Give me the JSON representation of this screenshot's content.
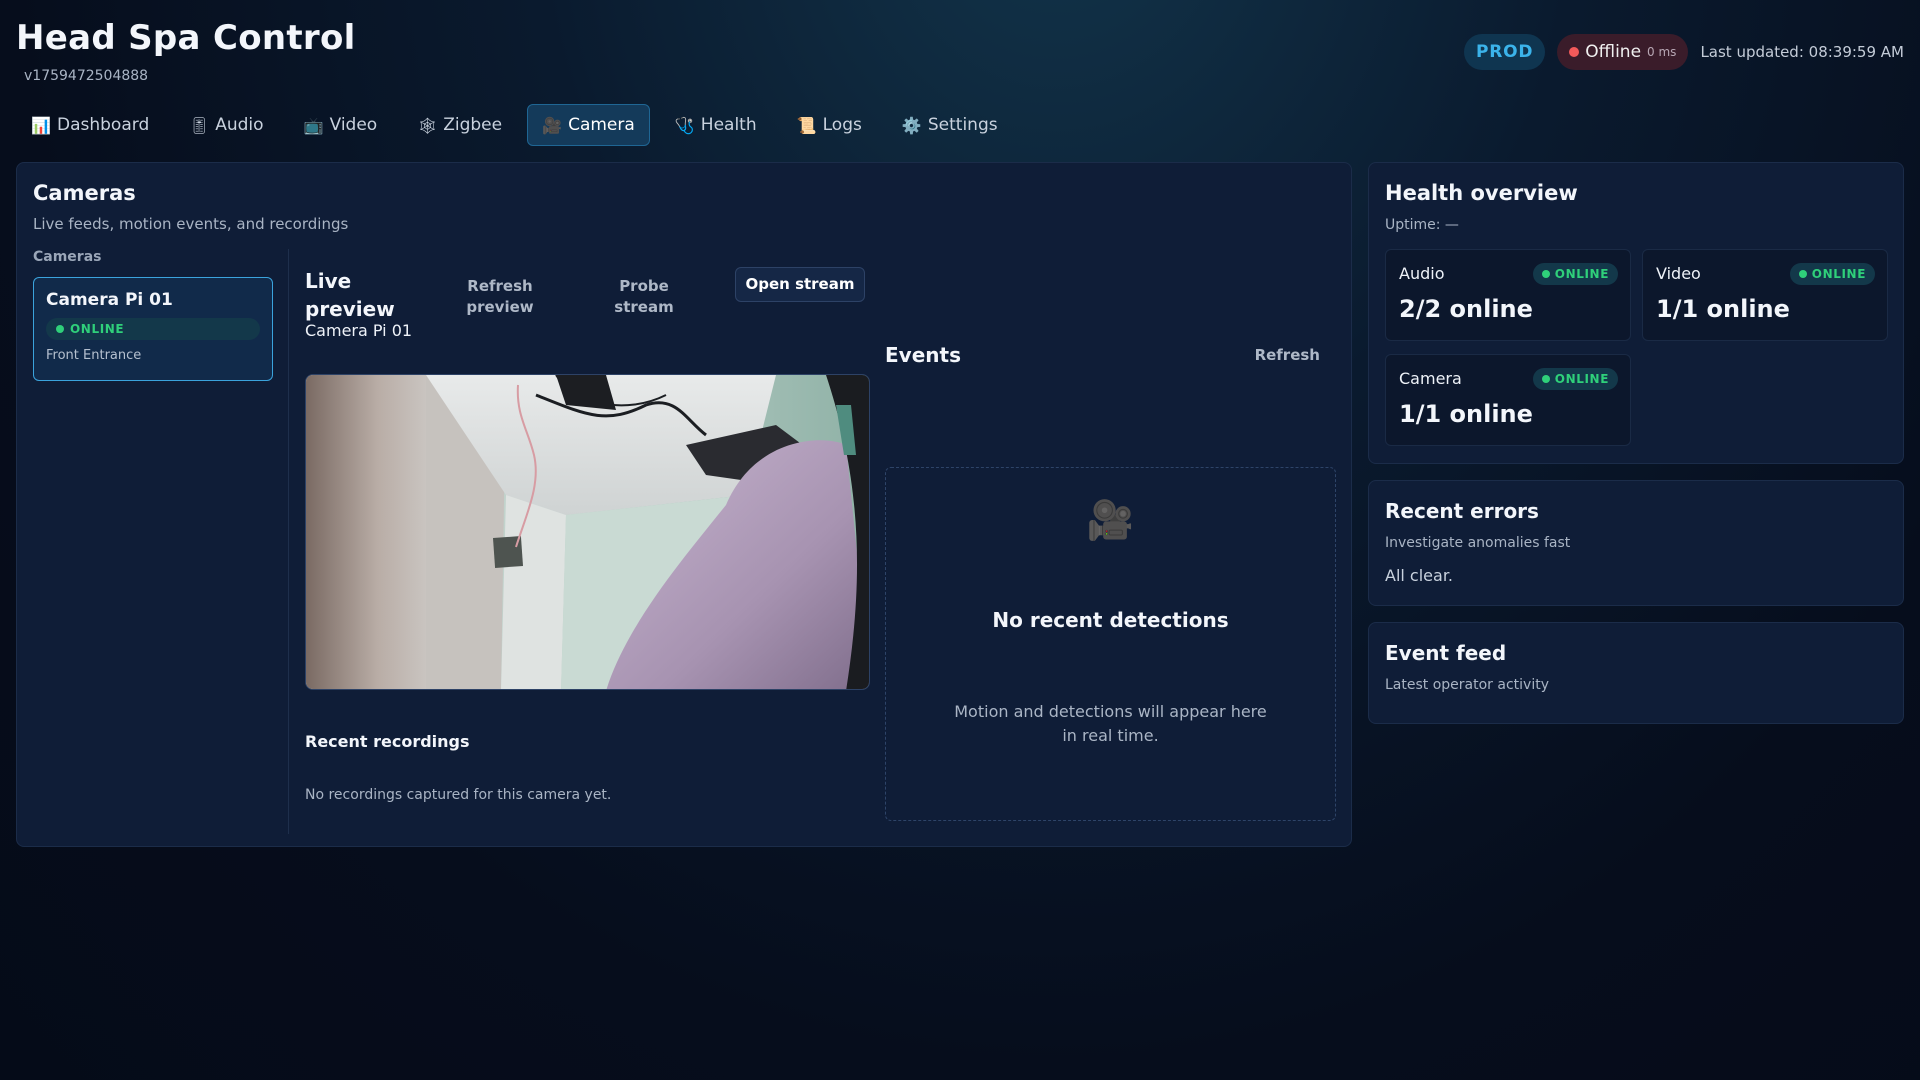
{
  "app": {
    "title": "Head Spa Control",
    "version": "v1759472504888"
  },
  "status": {
    "environment": "PROD",
    "connection": "Offline",
    "latency": "0 ms",
    "last_updated": "Last updated: 08:39:59 AM"
  },
  "nav": {
    "tabs": [
      {
        "label": "Dashboard",
        "icon": "bar-chart-icon",
        "glyph": "📊",
        "active": false
      },
      {
        "label": "Audio",
        "icon": "speaker-icon",
        "glyph": "🎚",
        "active": false
      },
      {
        "label": "Video",
        "icon": "tv-icon",
        "glyph": "📺",
        "active": false
      },
      {
        "label": "Zigbee",
        "icon": "network-icon",
        "glyph": "🕸",
        "active": false
      },
      {
        "label": "Camera",
        "icon": "video-camera-icon",
        "glyph": "🎥",
        "active": true
      },
      {
        "label": "Health",
        "icon": "stethoscope-icon",
        "glyph": "🩺",
        "active": false
      },
      {
        "label": "Logs",
        "icon": "scroll-icon",
        "glyph": "📜",
        "active": false
      },
      {
        "label": "Settings",
        "icon": "gear-icon",
        "glyph": "⚙️",
        "active": false
      }
    ]
  },
  "cameras_panel": {
    "title": "Cameras",
    "subtitle": "Live feeds, motion events, and recordings",
    "list_label": "Cameras",
    "cameras": [
      {
        "name": "Camera Pi 01",
        "status": "ONLINE",
        "location": "Front Entrance"
      }
    ]
  },
  "preview": {
    "title": "Live preview",
    "refresh_label": "Refresh preview",
    "probe_label": "Probe stream",
    "open_label": "Open stream",
    "camera_name": "Camera Pi 01",
    "recordings_title": "Recent recordings",
    "recordings_empty": "No recordings captured for this camera yet."
  },
  "events": {
    "title": "Events",
    "refresh_label": "Refresh",
    "empty_icon": "video-camera-icon",
    "empty_glyph": "🎥",
    "empty_title": "No recent detections",
    "empty_text": "Motion and detections will appear here in real time."
  },
  "health": {
    "title": "Health overview",
    "uptime": "Uptime: —",
    "tiles": [
      {
        "name": "Audio",
        "status": "ONLINE",
        "value": "2/2 online"
      },
      {
        "name": "Video",
        "status": "ONLINE",
        "value": "1/1 online"
      },
      {
        "name": "Camera",
        "status": "ONLINE",
        "value": "1/1 online"
      }
    ]
  },
  "errors": {
    "title": "Recent errors",
    "subtitle": "Investigate anomalies fast",
    "message": "All clear."
  },
  "event_feed": {
    "title": "Event feed",
    "subtitle": "Latest operator activity"
  },
  "colors": {
    "accent": "#3ba3dc",
    "online": "#2fd07a",
    "offline": "#f25a5a",
    "background": "#050b18"
  }
}
